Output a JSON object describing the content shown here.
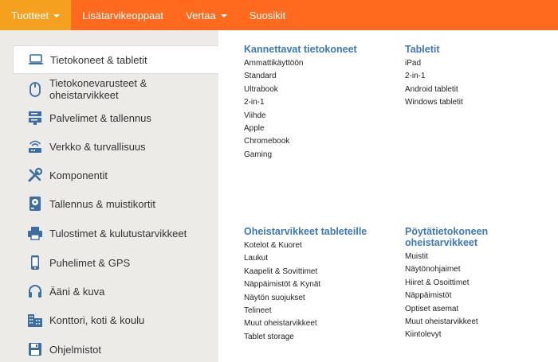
{
  "topnav": {
    "items": [
      {
        "label": "Tuotteet",
        "has_caret": true,
        "active": true
      },
      {
        "label": "Lisätarvikeoppaat",
        "has_caret": false,
        "active": false
      },
      {
        "label": "Vertaa",
        "has_caret": true,
        "active": false
      },
      {
        "label": "Suosikit",
        "has_caret": false,
        "active": false
      }
    ]
  },
  "sidebar": {
    "items": [
      {
        "label": "Tietokoneet & tabletit",
        "icon": "laptop-icon",
        "active": true
      },
      {
        "label": "Tietokonevarusteet & oheistarvikkeet",
        "icon": "mouse-icon"
      },
      {
        "label": "Palvelimet & tallennus",
        "icon": "server-icon"
      },
      {
        "label": "Verkko & turvallisuus",
        "icon": "router-icon"
      },
      {
        "label": "Komponentit",
        "icon": "tools-icon"
      },
      {
        "label": "Tallennus & muistikortit",
        "icon": "hard-drive-icon"
      },
      {
        "label": "Tulostimet & kulutustarvikkeet",
        "icon": "printer-icon"
      },
      {
        "label": "Puhelimet & GPS",
        "icon": "phone-icon"
      },
      {
        "label": "Ääni & kuva",
        "icon": "headphones-icon"
      },
      {
        "label": "Konttori, koti & koulu",
        "icon": "office-icon"
      },
      {
        "label": "Ohjelmistot",
        "icon": "floppy-icon"
      }
    ]
  },
  "menu": {
    "columns": [
      {
        "title": "Kannettavat tietokoneet",
        "links": [
          "Ammattikäyttöön",
          "Standard",
          "Ultrabook",
          "2-in-1",
          "Viihde",
          "Apple",
          "Chromebook",
          "Gaming"
        ]
      },
      {
        "title": "Tabletit",
        "links": [
          "iPad",
          "2-in-1",
          "Android tabletit",
          "Windows tabletit"
        ]
      },
      {
        "title": "Oheistarvikkeet tableteille",
        "links": [
          "Kotelot & Kuoret",
          "Laukut",
          "Kaapelit & Sovittimet",
          "Näppäimistöt & Kynät",
          "Näytön suojukset",
          "Telineet",
          "Muut oheistarvikkeet",
          "Tablet storage"
        ]
      },
      {
        "title": "Pöytätietokoneen oheistarvikkeet",
        "links": [
          "Muistit",
          "Näytönohjaimet",
          "Hiiret & Osoittimet",
          "Näppäimistöt",
          "Optiset asemat",
          "Muut oheistarvikkeet",
          "Kiintolevyt"
        ]
      }
    ]
  },
  "colors": {
    "nav_bg": "#ff6a1f",
    "nav_active": "#f5a11f",
    "heading_blue": "#3c78b8",
    "sidebar_bg": "#ecebe8",
    "icon_blue": "#3a6ea5"
  }
}
